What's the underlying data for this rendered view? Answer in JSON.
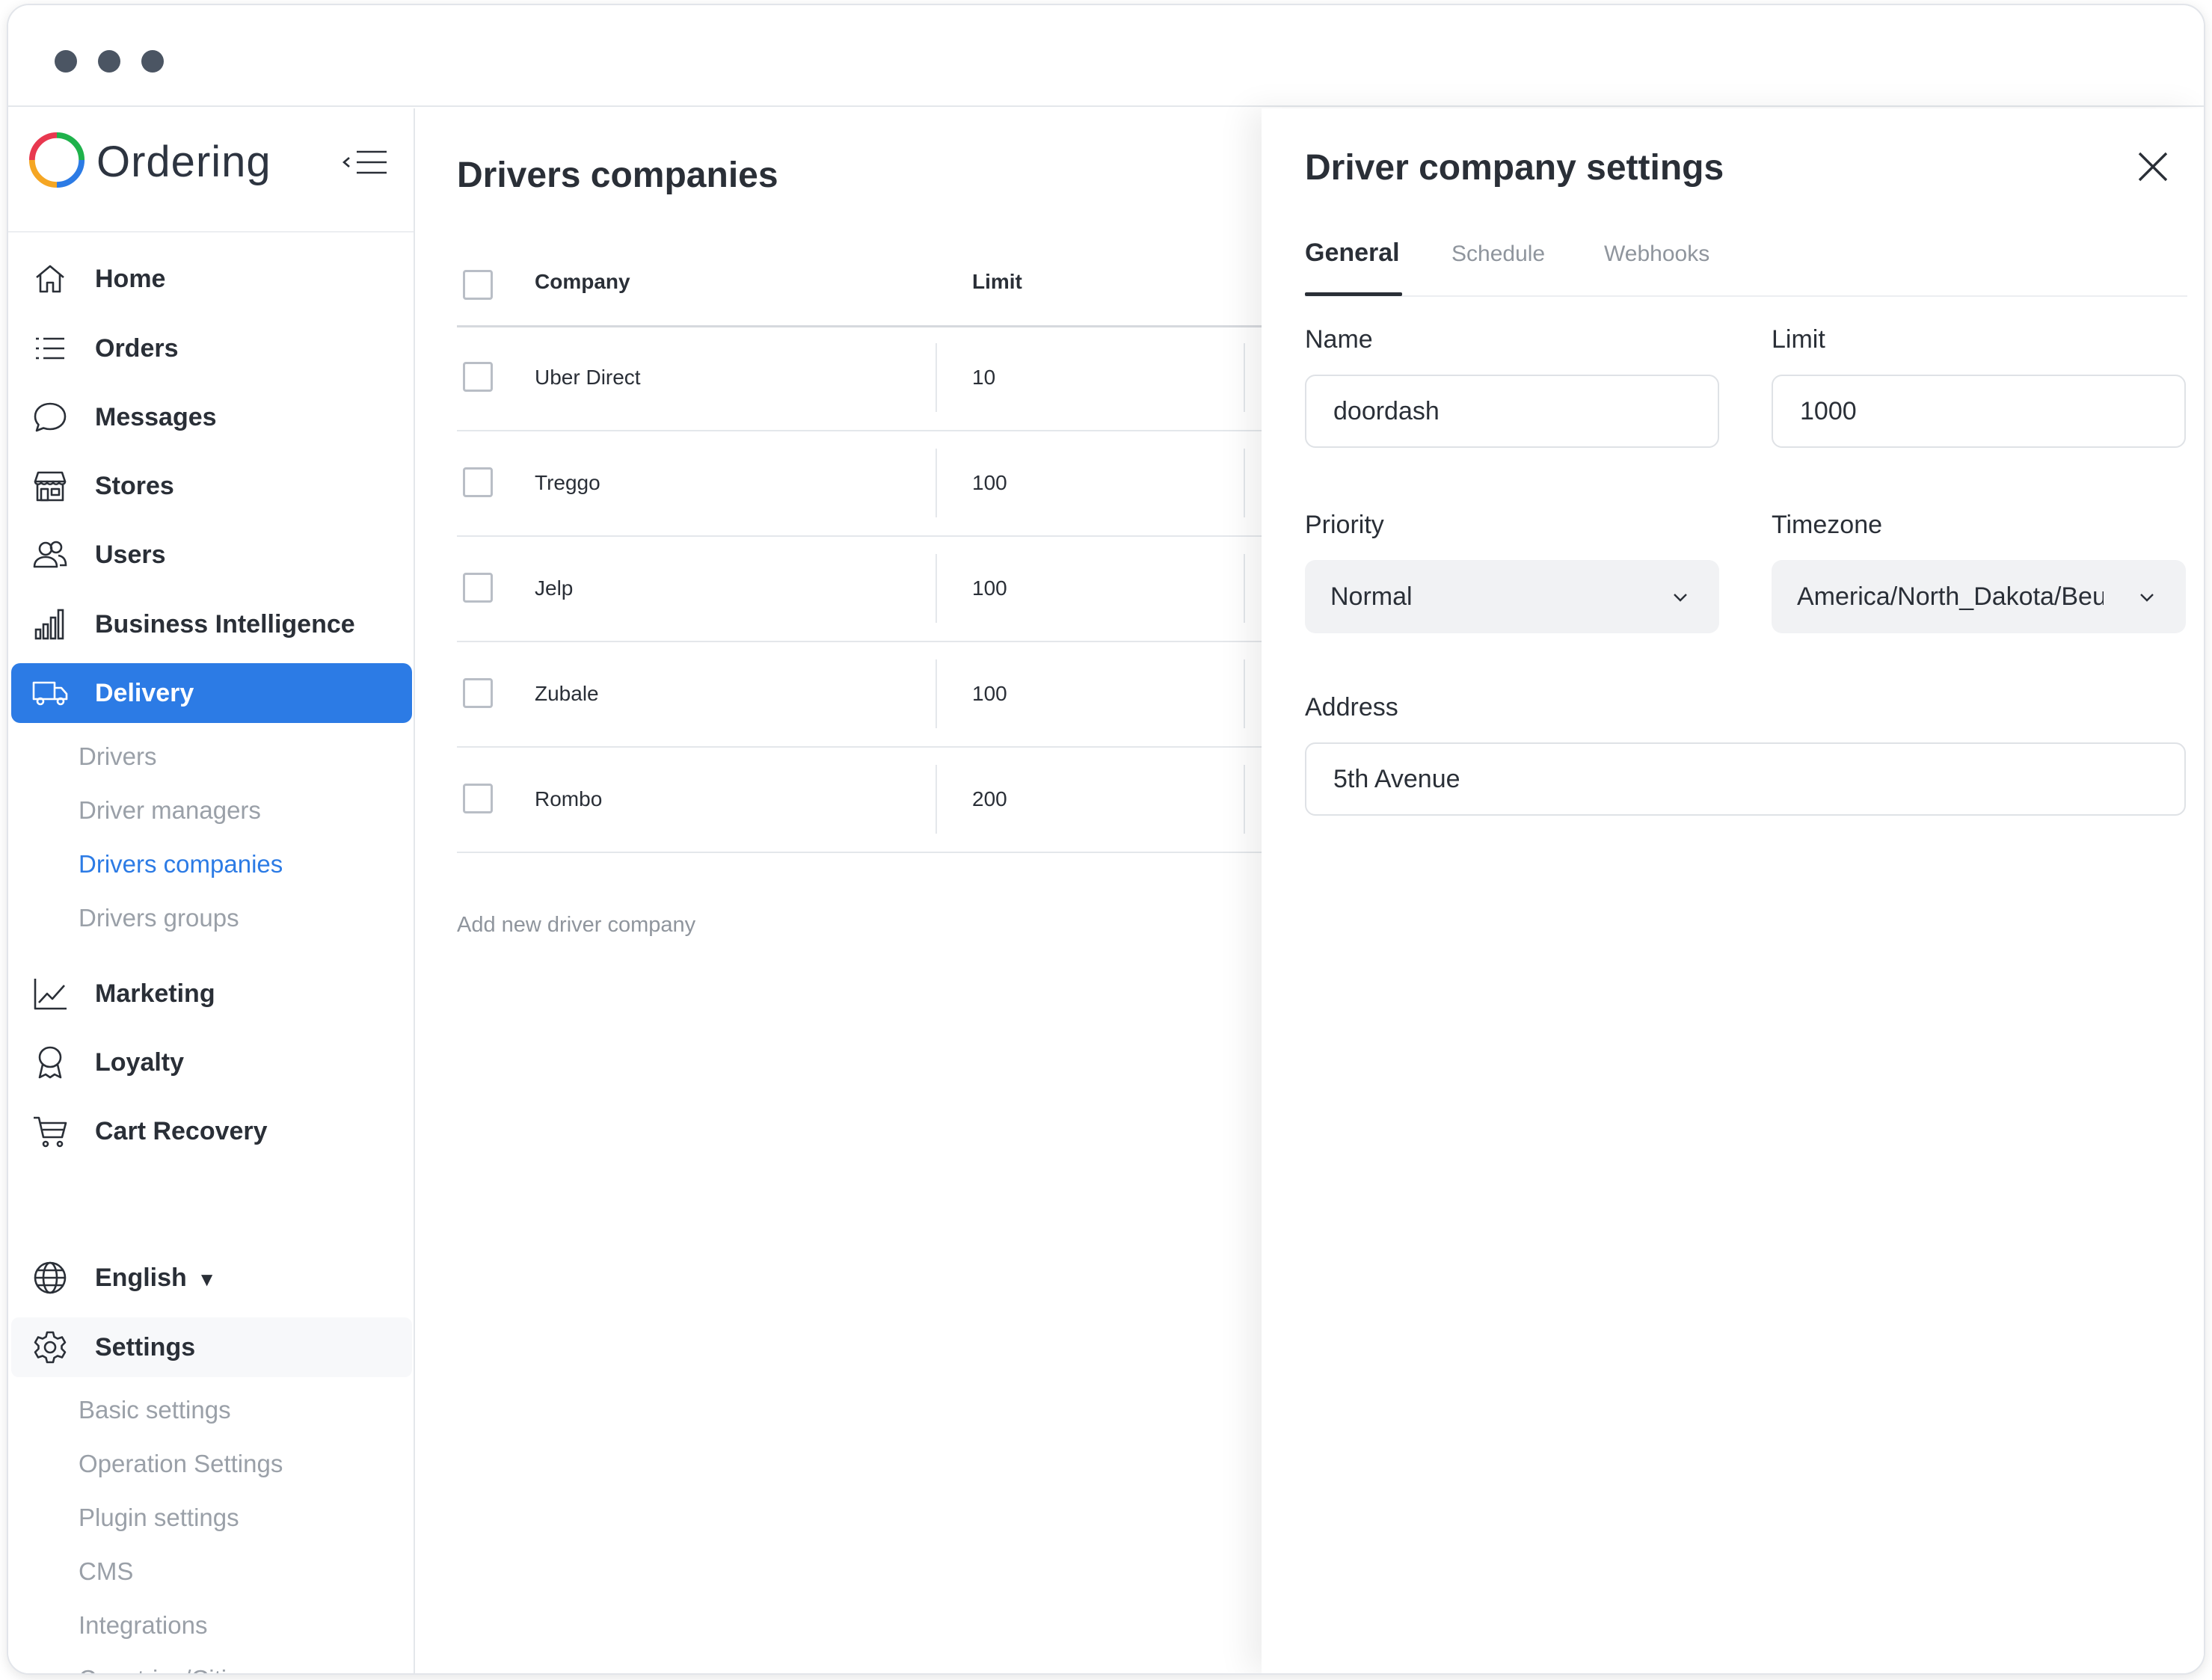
{
  "app": {
    "name": "Ordering"
  },
  "sidebar": {
    "nav": [
      {
        "id": "home",
        "label": "Home",
        "icon": "home-icon"
      },
      {
        "id": "orders",
        "label": "Orders",
        "icon": "list-icon"
      },
      {
        "id": "messages",
        "label": "Messages",
        "icon": "chat-bubble-icon"
      },
      {
        "id": "stores",
        "label": "Stores",
        "icon": "store-icon"
      },
      {
        "id": "users",
        "label": "Users",
        "icon": "users-icon"
      },
      {
        "id": "business-intelligence",
        "label": "Business Intelligence",
        "icon": "bar-chart-icon"
      },
      {
        "id": "delivery",
        "label": "Delivery",
        "icon": "truck-icon"
      }
    ],
    "delivery_sub": [
      {
        "label": "Drivers"
      },
      {
        "label": "Driver managers"
      },
      {
        "label": "Drivers companies"
      },
      {
        "label": "Drivers groups"
      }
    ],
    "nav2": [
      {
        "id": "marketing",
        "label": "Marketing",
        "icon": "line-chart-icon"
      },
      {
        "id": "loyalty",
        "label": "Loyalty",
        "icon": "award-icon"
      },
      {
        "id": "cart-recovery",
        "label": "Cart Recovery",
        "icon": "cart-icon"
      }
    ],
    "language": {
      "label": "English",
      "icon": "globe-icon"
    },
    "settings": {
      "label": "Settings",
      "icon": "gear-icon"
    },
    "settings_sub": [
      {
        "label": "Basic settings"
      },
      {
        "label": "Operation Settings"
      },
      {
        "label": "Plugin settings"
      },
      {
        "label": "CMS"
      },
      {
        "label": "Integrations"
      },
      {
        "label": "Countries/Cities"
      }
    ]
  },
  "main": {
    "title": "Drivers companies",
    "columns": {
      "company": "Company",
      "limit": "Limit"
    },
    "rows": [
      {
        "company": "Uber Direct",
        "limit": "10"
      },
      {
        "company": "Treggo",
        "limit": "100"
      },
      {
        "company": "Jelp",
        "limit": "100"
      },
      {
        "company": "Zubale",
        "limit": "100"
      },
      {
        "company": "Rombo",
        "limit": "200"
      }
    ],
    "add_label": "Add new driver company"
  },
  "panel": {
    "title": "Driver company settings",
    "tabs": [
      {
        "label": "General",
        "active": true
      },
      {
        "label": "Schedule",
        "active": false
      },
      {
        "label": "Webhooks",
        "active": false
      }
    ],
    "fields": {
      "name": {
        "label": "Name",
        "value": "doordash"
      },
      "limit": {
        "label": "Limit",
        "value": "1000"
      },
      "priority": {
        "label": "Priority",
        "value": "Normal"
      },
      "timezone": {
        "label": "Timezone",
        "value": "America/North_Dakota/Beulah"
      },
      "address": {
        "label": "Address",
        "value": "5th Avenue"
      }
    }
  },
  "colors": {
    "accent": "#2c7be5",
    "text": "#2a2f37",
    "muted": "#9aa0a8"
  }
}
